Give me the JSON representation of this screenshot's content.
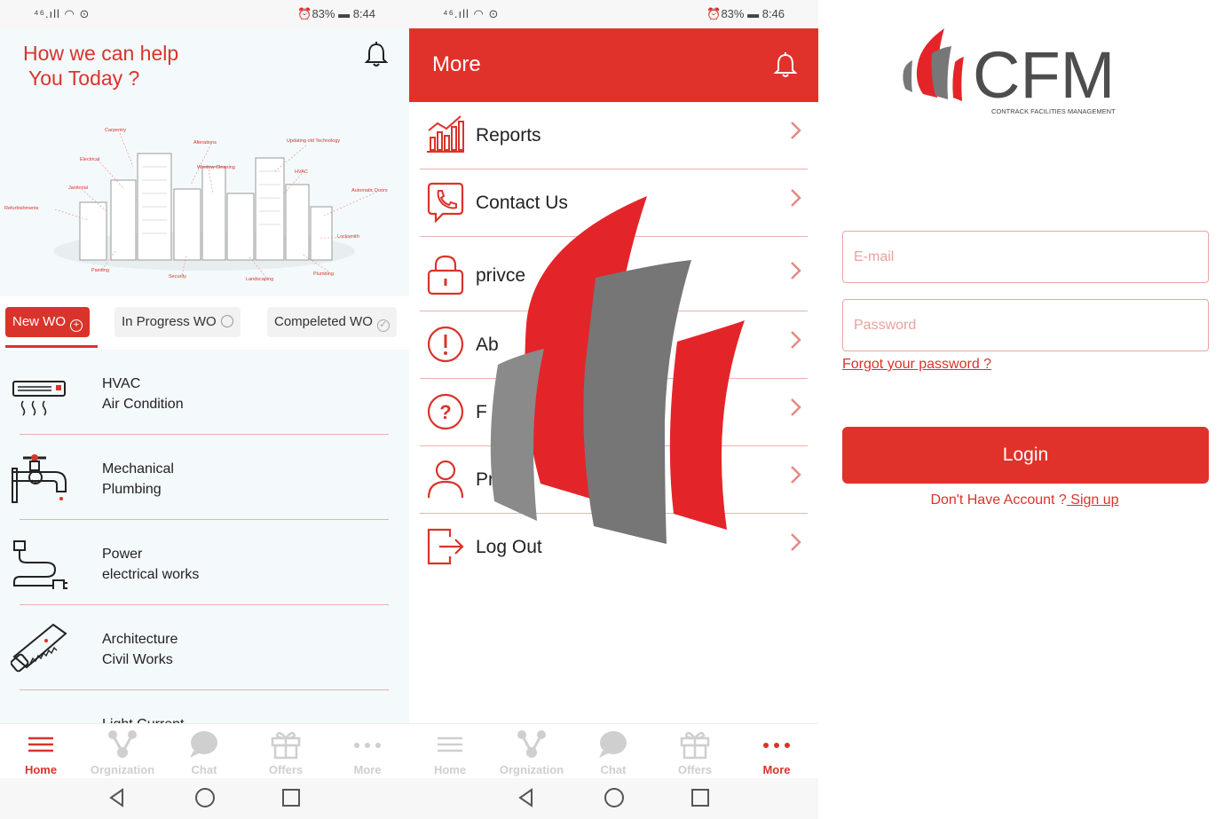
{
  "colors": {
    "accent": "#e0322a",
    "dark_gray": "#5a5a5a",
    "divider": "#e7b3b0"
  },
  "screen1": {
    "status": {
      "left": "⁴⁶.ıll ◠ ⊙",
      "right": "⏰83% ▬ 8:44"
    },
    "title_line1": "How we can help",
    "title_line2": "You Today ?",
    "hero_labels": [
      "Carpentry",
      "Alterations",
      "Electrical",
      "Window Cleaning",
      "Updating old Technology",
      "HVAC",
      "Janitorial",
      "Refurbishments",
      "Automatic Doors",
      "Locksmith",
      "Painting",
      "Security",
      "Landscaping",
      "Plumbing"
    ],
    "tabs": [
      {
        "label": "New WO",
        "icon": "plus-circle-icon"
      },
      {
        "label": "In Progress WO",
        "icon": "circle-icon"
      },
      {
        "label": "Compeleted WO",
        "icon": "check-circle-icon"
      }
    ],
    "services": [
      {
        "line1": "HVAC",
        "line2": "Air Condition",
        "icon": "air-conditioner-icon"
      },
      {
        "line1": "Mechanical",
        "line2": "Plumbing",
        "icon": "faucet-icon"
      },
      {
        "line1": "Power",
        "line2": "electrical works",
        "icon": "plug-icon"
      },
      {
        "line1": "Architecture",
        "line2": "Civil Works",
        "icon": "saw-icon"
      },
      {
        "line1": "Light Current",
        "line2": "",
        "icon": "camera-icon"
      }
    ],
    "nav": [
      "Home",
      "Orgnization",
      "Chat",
      "Offers",
      "More"
    ]
  },
  "screen2": {
    "status": {
      "left": "⁴⁶.ıll ◠ ⊙",
      "right": "⏰83% ▬ 8:46"
    },
    "title": "More",
    "menu": [
      "Reports",
      "Contact Us",
      "privce",
      "Ab",
      "F",
      "Pro",
      "Log Out"
    ],
    "nav": [
      "Home",
      "Orgnization",
      "Chat",
      "Offers",
      "More"
    ]
  },
  "screen3": {
    "logo_text": "CFM",
    "logo_sub": "CONTRACK FACILITIES MANAGEMENT",
    "email_placeholder": "E-mail",
    "password_placeholder": "Password",
    "forgot": "Forgot your password ?",
    "login": "Login",
    "no_account": "Don't Have Account ?",
    "signup": " Sign up"
  }
}
